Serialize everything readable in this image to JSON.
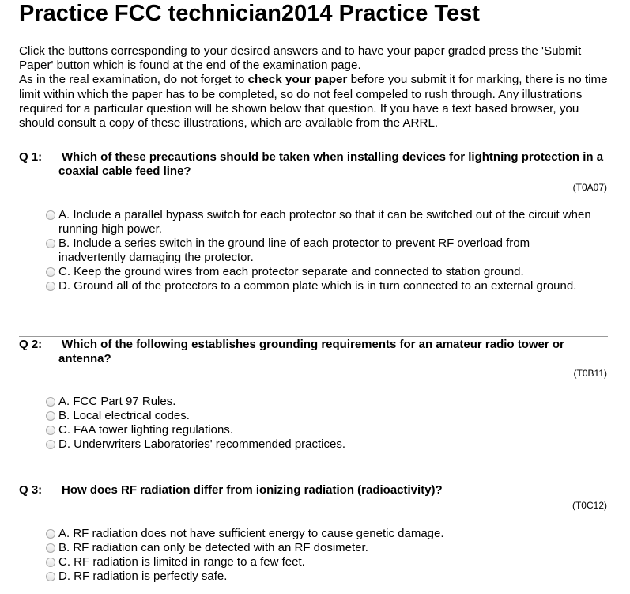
{
  "header": {
    "title": "Practice FCC technician2014 Practice Test"
  },
  "intro": {
    "line1": "Click the buttons corresponding to your desired answers and to have your paper graded press the 'Submit Paper' button which is found at the end of the examination page.",
    "line2_pre": "As in the real examination, do not forget to ",
    "line2_bold": "check your paper",
    "line2_post": " before you submit it for marking, there is no time limit within which the paper has to be completed, so do not feel compeled to rush through. Any illustrations required for a particular question will be shown below that question. If you have a text based browser, you should consult a copy of these illustrations, which are available from the ARRL."
  },
  "questions": [
    {
      "number": "Q 1:",
      "text": "Which of these precautions should be taken when installing devices for lightning protection in a coaxial cable feed line?",
      "code": "(T0A07)",
      "answers": [
        "A. Include a parallel bypass switch for each protector so that it can be switched out of the circuit when running high power.",
        "B. Include a series switch in the ground line of each protector to prevent RF overload from inadvertently damaging the protector.",
        "C. Keep the ground wires from each protector separate and connected to station ground.",
        "D. Ground all of the protectors to a common plate which is in turn connected to an external ground."
      ]
    },
    {
      "number": "Q 2:",
      "text": "Which of the following establishes grounding requirements for an amateur radio tower or antenna?",
      "code": "(T0B11)",
      "answers": [
        "A. FCC Part 97 Rules.",
        "B. Local electrical codes.",
        "C. FAA tower lighting regulations.",
        "D. Underwriters Laboratories' recommended practices."
      ]
    },
    {
      "number": "Q 3:",
      "text": "How does RF radiation differ from ionizing radiation (radioactivity)?",
      "code": "(T0C12)",
      "answers": [
        "A. RF radiation does not have sufficient energy to cause genetic damage.",
        "B. RF radiation can only be detected with an RF dosimeter.",
        "C. RF radiation is limited in range to a few feet.",
        "D. RF radiation is perfectly safe."
      ]
    }
  ]
}
